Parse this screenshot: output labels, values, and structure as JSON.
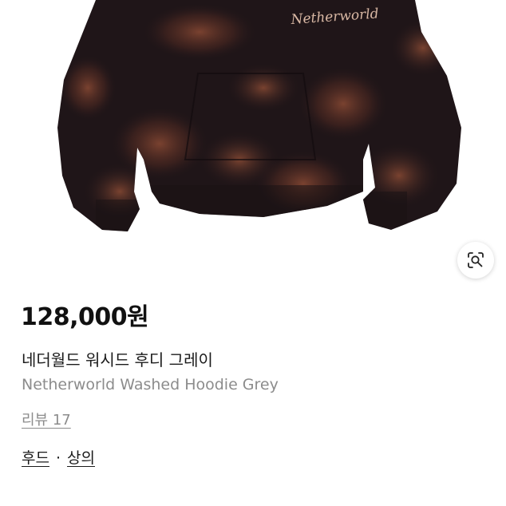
{
  "product": {
    "image": {
      "alt": "Netherworld Washed Hoodie",
      "embroidery_text": "Netherworld"
    },
    "lens_icon": "image-search-icon",
    "price": "128,000원",
    "title_ko": "네더월드 워시드 후디 그레이",
    "title_en": "Netherworld Washed Hoodie Grey",
    "reviews_label": "리뷰 17",
    "categories": [
      "후드",
      "상의"
    ],
    "category_separator": "·"
  },
  "colors": {
    "hoodie_base": "#1f1518",
    "bleach_stain": "#6e3a2a",
    "embroidery": "#d9b8a4"
  }
}
